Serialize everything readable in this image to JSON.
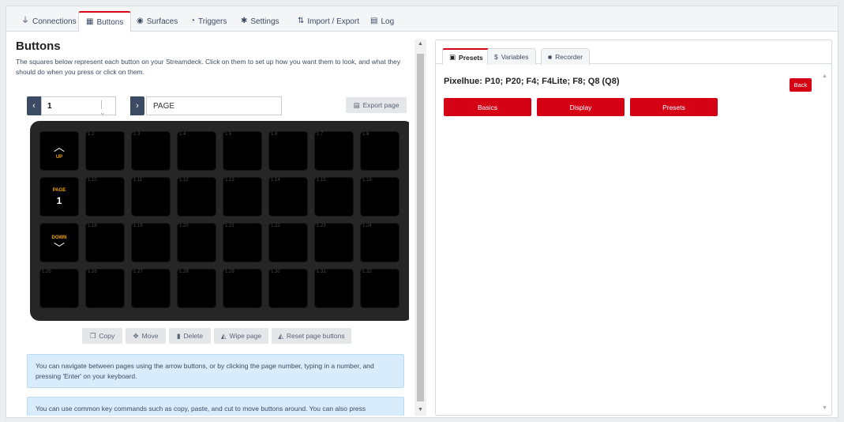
{
  "topnav": {
    "tabs": [
      {
        "label": "Connections",
        "icon": "plug-icon",
        "glyph": "⏚"
      },
      {
        "label": "Buttons",
        "icon": "calendar-grid-icon",
        "glyph": "▦"
      },
      {
        "label": "Surfaces",
        "icon": "gamepad-icon",
        "glyph": "◉"
      },
      {
        "label": "Triggers",
        "icon": "clock-icon",
        "glyph": "◔"
      },
      {
        "label": "Settings",
        "icon": "gear-icon",
        "glyph": "✱"
      },
      {
        "label": "Import / Export",
        "icon": "file-import-icon",
        "glyph": "⇅"
      },
      {
        "label": "Log",
        "icon": "clipboard-icon",
        "glyph": "▤"
      }
    ],
    "active": "Buttons"
  },
  "buttons_panel": {
    "title": "Buttons",
    "description": "The squares below represent each button on your Streamdeck. Click on them to set up how you want them to look, and what they should do when you press or click on them.",
    "page_number": "1",
    "page_name": "PAGE",
    "export_label": "Export page",
    "keys": {
      "up_label": "UP",
      "page_label": "PAGE",
      "page_value": "1",
      "down_label": "DOWN",
      "row1": [
        "1.2",
        "1.3",
        "1.4",
        "1.5",
        "1.6",
        "1.7",
        "1.8"
      ],
      "row2": [
        "1.10",
        "1.11",
        "1.12",
        "1.13",
        "1.14",
        "1.15",
        "1.16"
      ],
      "row3": [
        "1.18",
        "1.19",
        "1.20",
        "1.21",
        "1.22",
        "1.23",
        "1.24"
      ],
      "row4": [
        "1.25",
        "1.26",
        "1.27",
        "1.28",
        "1.29",
        "1.30",
        "1.31",
        "1.32"
      ]
    },
    "actions": {
      "copy": "Copy",
      "move": "Move",
      "delete": "Delete",
      "wipe": "Wipe page",
      "reset": "Reset page buttons"
    },
    "info1": "You can navigate between pages using the arrow buttons, or by clicking the page number, typing in a number, and pressing 'Enter' on your keyboard.",
    "info2": "You can use common key commands such as copy, paste, and cut to move buttons around. You can also press"
  },
  "right_panel": {
    "tabs": [
      {
        "label": "Presets",
        "icon": "gift-icon",
        "glyph": "▣"
      },
      {
        "label": "Variables",
        "icon": "dollar-icon",
        "glyph": "$"
      },
      {
        "label": "Recorder",
        "icon": "video-icon",
        "glyph": "■"
      }
    ],
    "active": "Presets",
    "instance_title": "Pixelhue: P10; P20; F4; F4Lite; F8; Q8 (Q8)",
    "back_label": "Back",
    "categories": [
      "Basics",
      "Display",
      "Presets"
    ]
  },
  "colors": {
    "accent": "#d50215",
    "key_label": "#f0a500",
    "nav": "#3c4b64"
  }
}
